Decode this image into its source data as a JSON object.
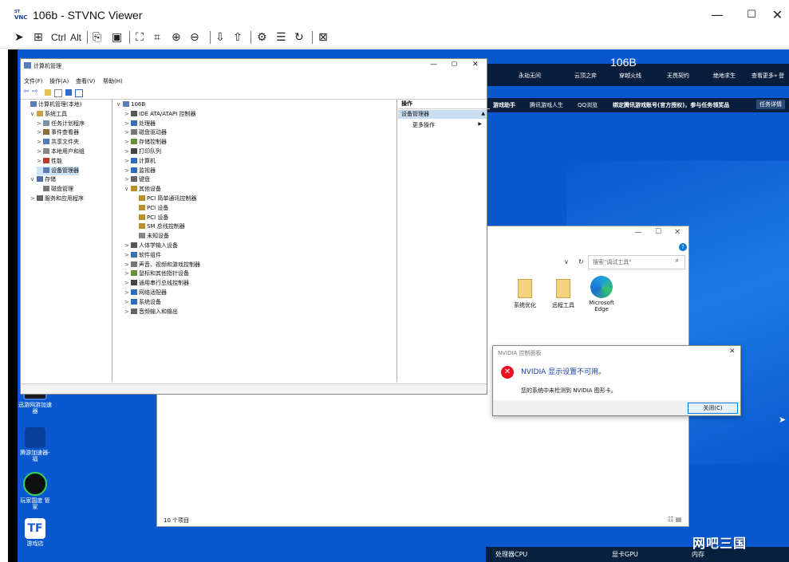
{
  "vnc": {
    "title": "106b - STVNC Viewer",
    "logo_text": "VNC",
    "controls": {
      "minimize": "—",
      "maximize": "☐",
      "close": "✕"
    },
    "toolbar": {
      "ctrl": "Ctrl",
      "alt": "Alt"
    }
  },
  "game_banner": {
    "server_label": "106B",
    "items": [
      "永劫无间",
      "云顶之弈",
      "穿越火线",
      "无畏契约",
      "绝地求生",
      "查看更多»",
      "登"
    ],
    "row2": [
      "游戏助手",
      "腾讯游戏人生",
      "QQ浏览",
      "绑定腾讯游戏账号(官方授权)，参与任务领奖品",
      "任务详情"
    ]
  },
  "mmc": {
    "title": "计算机管理",
    "menu": [
      "文件(F)",
      "操作(A)",
      "查看(V)",
      "帮助(H)"
    ],
    "controls": {
      "minimize": "—",
      "maximize": "☐",
      "close": "✕"
    },
    "left_tree": [
      {
        "label": "计算机管理(本地)",
        "indent": 0,
        "exp": ""
      },
      {
        "label": "系统工具",
        "indent": 1,
        "exp": "∨"
      },
      {
        "label": "任务计划程序",
        "indent": 2,
        "exp": ">"
      },
      {
        "label": "事件查看器",
        "indent": 2,
        "exp": ">"
      },
      {
        "label": "共享文件夹",
        "indent": 2,
        "exp": ">"
      },
      {
        "label": "本地用户和组",
        "indent": 2,
        "exp": ">"
      },
      {
        "label": "性能",
        "indent": 2,
        "exp": ">"
      },
      {
        "label": "设备管理器",
        "indent": 2,
        "exp": ""
      },
      {
        "label": "存储",
        "indent": 1,
        "exp": "∨"
      },
      {
        "label": "磁盘管理",
        "indent": 2,
        "exp": ""
      },
      {
        "label": "服务和应用程序",
        "indent": 1,
        "exp": ">"
      }
    ],
    "device_root": "106B",
    "devices": [
      {
        "label": "IDE ATA/ATAPI 控制器",
        "indent": 1,
        "exp": ">"
      },
      {
        "label": "处理器",
        "indent": 1,
        "exp": ">"
      },
      {
        "label": "磁盘驱动器",
        "indent": 1,
        "exp": ">"
      },
      {
        "label": "存储控制器",
        "indent": 1,
        "exp": ">"
      },
      {
        "label": "打印队列",
        "indent": 1,
        "exp": ">"
      },
      {
        "label": "计算机",
        "indent": 1,
        "exp": ">"
      },
      {
        "label": "监视器",
        "indent": 1,
        "exp": ">"
      },
      {
        "label": "键盘",
        "indent": 1,
        "exp": ">"
      },
      {
        "label": "其他设备",
        "indent": 1,
        "exp": "∨"
      },
      {
        "label": "PCI 简单通讯控制器",
        "indent": 2,
        "exp": ""
      },
      {
        "label": "PCI 设备",
        "indent": 2,
        "exp": ""
      },
      {
        "label": "PCI 设备",
        "indent": 2,
        "exp": ""
      },
      {
        "label": "SM 总线控制器",
        "indent": 2,
        "exp": ""
      },
      {
        "label": "未知设备",
        "indent": 2,
        "exp": ""
      },
      {
        "label": "人体学输入设备",
        "indent": 1,
        "exp": ">"
      },
      {
        "label": "软件组件",
        "indent": 1,
        "exp": ">"
      },
      {
        "label": "声音、视频和游戏控制器",
        "indent": 1,
        "exp": ">"
      },
      {
        "label": "鼠标和其他指针设备",
        "indent": 1,
        "exp": ">"
      },
      {
        "label": "通用串行总线控制器",
        "indent": 1,
        "exp": ">"
      },
      {
        "label": "网络适配器",
        "indent": 1,
        "exp": ">"
      },
      {
        "label": "系统设备",
        "indent": 1,
        "exp": ">"
      },
      {
        "label": "音频输入和输出",
        "indent": 1,
        "exp": ">"
      }
    ],
    "actions": {
      "header": "操作",
      "section": "设备管理器",
      "more": "更多操作"
    }
  },
  "explorer": {
    "search_placeholder": "搜索\"调试工具\"",
    "items": [
      "系统优化",
      "远程工具",
      "Microsoft Edge"
    ],
    "status": "10 个项目",
    "help": "?"
  },
  "nvidia_dialog": {
    "title": "NVIDIA 控制面板",
    "heading": "NVIDIA 显示设置不可用。",
    "message": "您的系统中未检测到 NVIDIA 图形卡。",
    "close_button": "关闭(C)",
    "close_icon": "✕"
  },
  "desktop_icons": [
    "迅游网游加速器",
    "腾游加速器-福",
    "玩家国度 管家",
    "游戏店"
  ],
  "perf_bar": {
    "cpu": "处理器CPU",
    "gpu": "显卡GPU",
    "mem": "内存"
  },
  "watermark": "网吧三国",
  "colors": {
    "desktop": "#0a58d0",
    "accent": "#0078d7",
    "error": "#e81123"
  }
}
